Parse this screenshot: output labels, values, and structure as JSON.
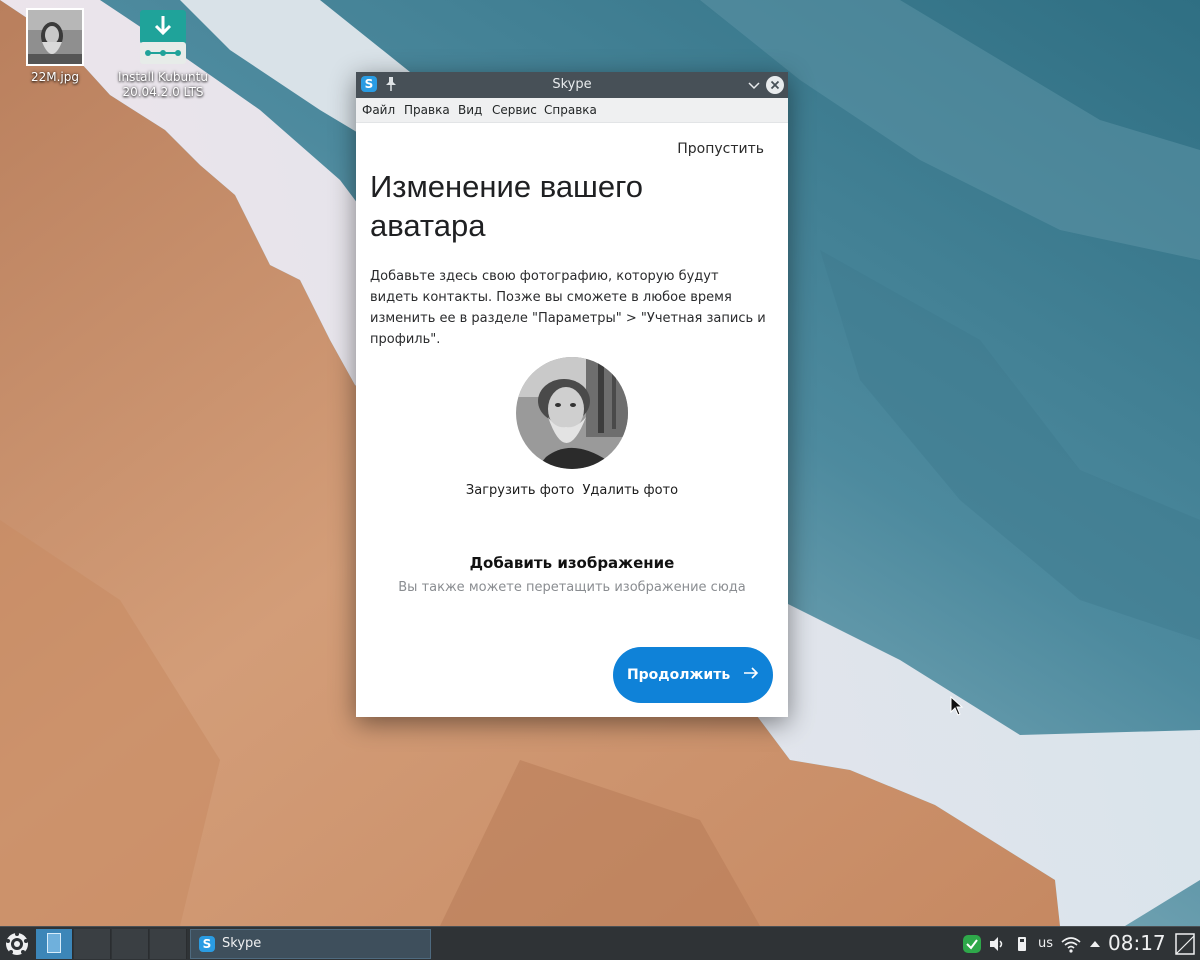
{
  "desktop": {
    "icons": [
      {
        "label": "22M.jpg"
      },
      {
        "label": "Install Kubuntu 20.04.2.0 LTS"
      }
    ]
  },
  "window": {
    "title": "Skype",
    "menu": [
      "Файл",
      "Правка",
      "Вид",
      "Сервис",
      "Справка"
    ],
    "skip": "Пропустить",
    "heading": "Изменение вашего аватара",
    "description": "Добавьте здесь свою фотографию, которую будут видеть контакты. Позже вы сможете в любое время изменить ее в разделе \"Параметры\" > \"Учетная запись и профиль\".",
    "upload": "Загрузить фото",
    "remove": "Удалить фото",
    "add_title": "Добавить изображение",
    "add_subtitle": "Вы также можете перетащить изображение сюда",
    "continue": "Продолжить"
  },
  "taskbar": {
    "task_label": "Skype",
    "keyboard_layout": "us",
    "clock": "08:17",
    "skype_badge": "S"
  },
  "colors": {
    "accent": "#0f82d8",
    "titlebar": "#475057",
    "taskbar": "#2f3336",
    "skype_blue": "#2a9ce3"
  }
}
